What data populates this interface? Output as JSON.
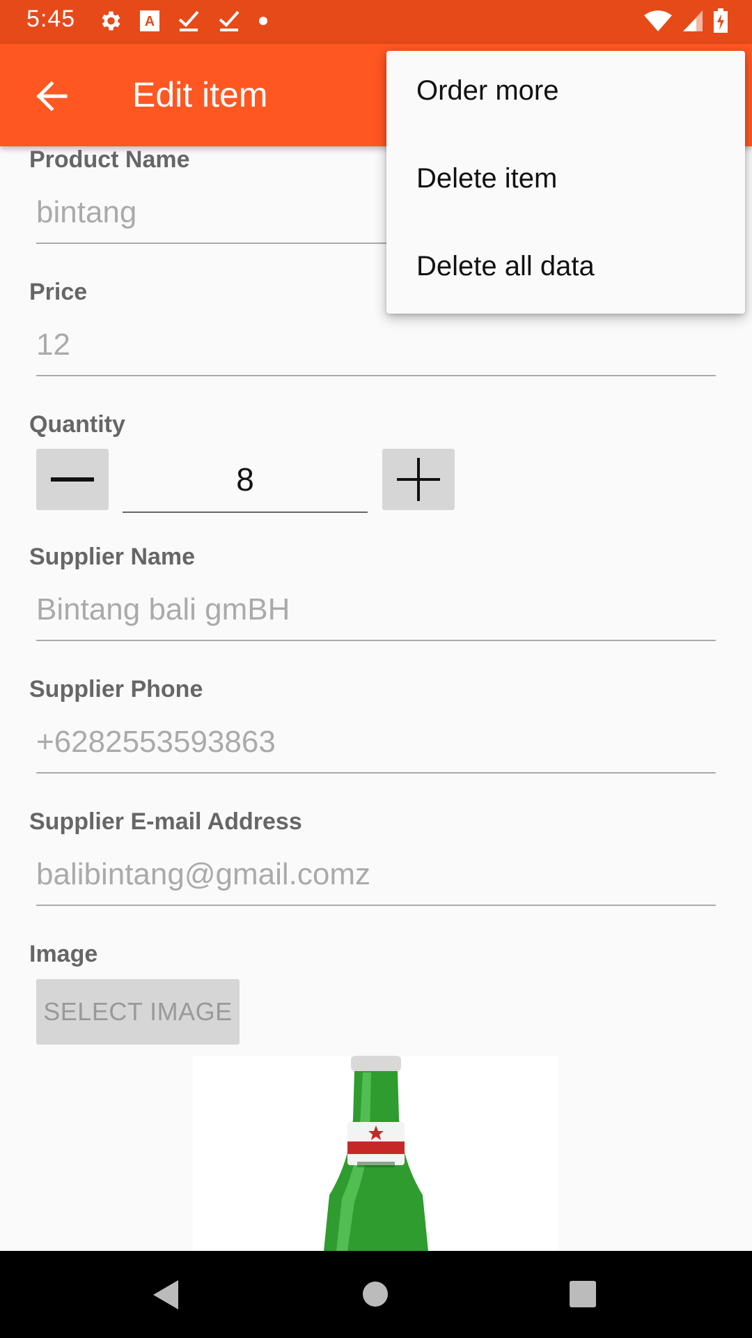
{
  "status_bar": {
    "time": "5:45",
    "icons_left": [
      "gear-icon",
      "text-a-icon",
      "check-icon",
      "check-icon",
      "dot-icon"
    ],
    "icons_right": [
      "wifi-icon",
      "signal-icon",
      "battery-charging-icon"
    ],
    "color": "#e64a19"
  },
  "app_bar": {
    "title": "Edit item",
    "back_icon": "arrow-left-icon",
    "color": "#ff5722"
  },
  "form": {
    "product_name": {
      "label": "Product Name",
      "value": "bintang"
    },
    "price": {
      "label": "Price",
      "value": "12"
    },
    "quantity": {
      "label": "Quantity",
      "value": "8"
    },
    "supplier_name": {
      "label": "Supplier Name",
      "value": "Bintang bali gmBH"
    },
    "supplier_phone": {
      "label": "Supplier Phone",
      "value": "+6282553593863"
    },
    "supplier_email": {
      "label": "Supplier E-mail Address",
      "value": "balibintang@gmail.comz"
    },
    "image": {
      "label": "Image",
      "button_label": "SELECT IMAGE"
    }
  },
  "overflow_menu": {
    "items": [
      "Order more",
      "Delete item",
      "Delete all data"
    ]
  },
  "nav_bar": {
    "icons": [
      "back-triangle-icon",
      "home-circle-icon",
      "recents-square-icon"
    ]
  }
}
